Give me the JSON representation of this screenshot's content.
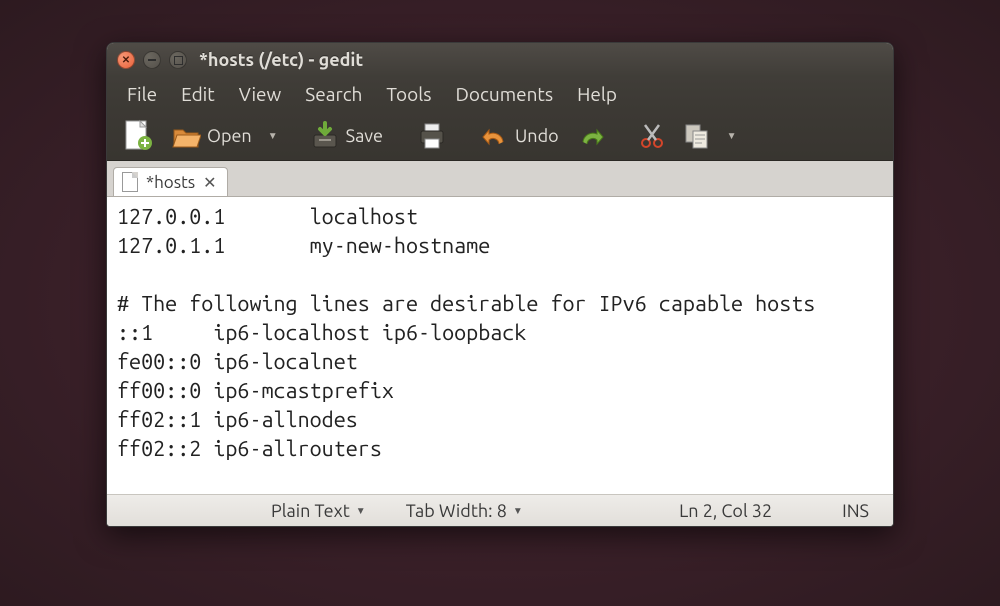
{
  "window": {
    "title": "*hosts (/etc) - gedit"
  },
  "menubar": [
    "File",
    "Edit",
    "View",
    "Search",
    "Tools",
    "Documents",
    "Help"
  ],
  "toolbar": {
    "open_label": "Open",
    "save_label": "Save",
    "undo_label": "Undo"
  },
  "tab": {
    "label": "*hosts"
  },
  "editor": {
    "content": "127.0.0.1       localhost\n127.0.1.1       my-new-hostname\n\n# The following lines are desirable for IPv6 capable hosts\n::1     ip6-localhost ip6-loopback\nfe00::0 ip6-localnet\nff00::0 ip6-mcastprefix\nff02::1 ip6-allnodes\nff02::2 ip6-allrouters"
  },
  "statusbar": {
    "syntax": "Plain Text",
    "tabwidth_label": "Tab Width: 8",
    "position": "Ln 2, Col 32",
    "mode": "INS"
  }
}
